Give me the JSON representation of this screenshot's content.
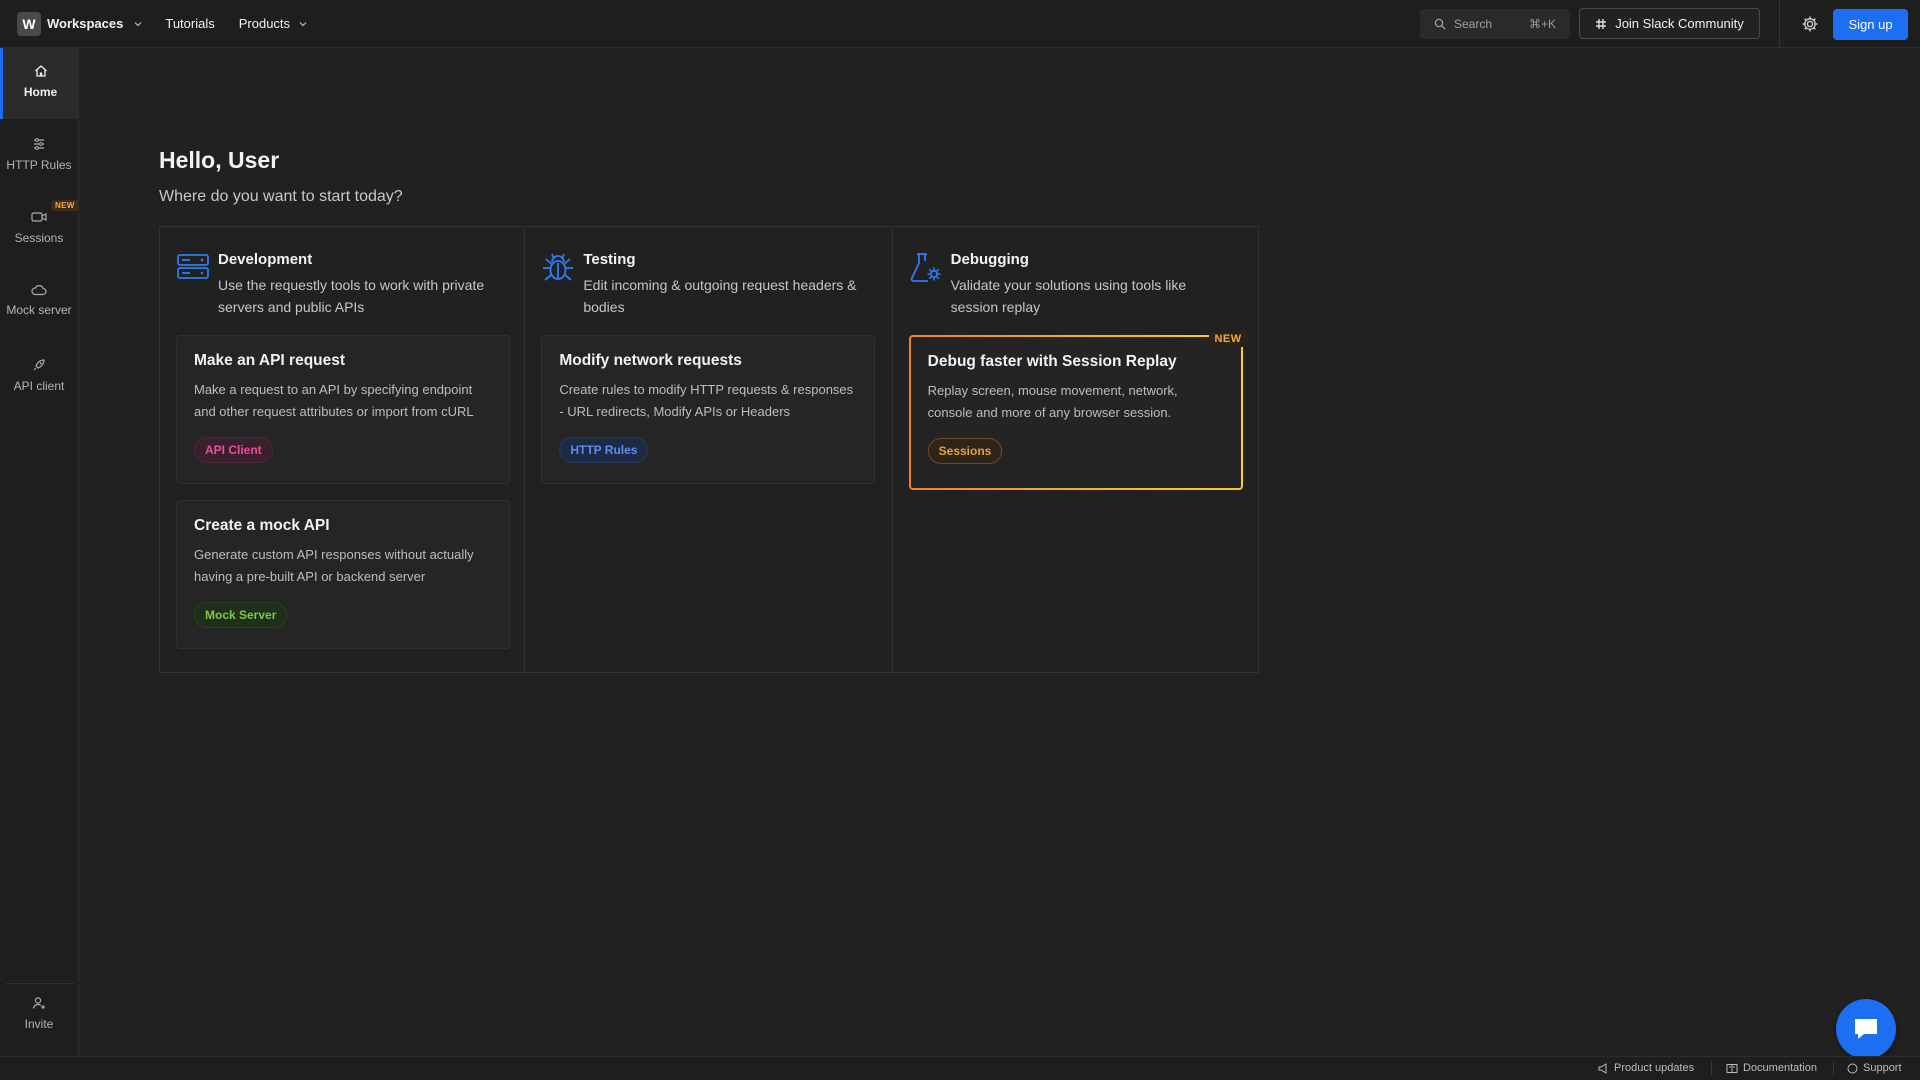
{
  "topbar": {
    "workspace_initial": "W",
    "workspace_label": "Workspaces",
    "tutorials": "Tutorials",
    "products": "Products",
    "search_label": "Search",
    "search_shortcut": "⌘+K",
    "slack_label": "Join Slack Community",
    "signup_label": "Sign up"
  },
  "sidebar": {
    "items": [
      {
        "label": "Home",
        "icon": "home-icon"
      },
      {
        "label": "HTTP Rules",
        "icon": "sliders-icon"
      },
      {
        "label": "Sessions",
        "icon": "video-icon",
        "badge": "NEW"
      },
      {
        "label": "Mock server",
        "icon": "cloud-icon"
      },
      {
        "label": "API client",
        "icon": "rocket-icon"
      }
    ],
    "invite_label": "Invite"
  },
  "main": {
    "greeting": "Hello, User",
    "subtitle": "Where do you want to start today?",
    "columns": [
      {
        "title": "Development",
        "description": "Use the requestly tools to work with private servers and public APIs",
        "icon": "server-icon",
        "cards": [
          {
            "title": "Make an API request",
            "description": "Make a request to an API by specifying endpoint and other request attributes or import from cURL",
            "tag": "API Client"
          },
          {
            "title": "Create a mock API",
            "description": "Generate custom API responses without actually having a pre-built API or backend server",
            "tag": "Mock Server"
          }
        ]
      },
      {
        "title": "Testing",
        "description": "Edit incoming & outgoing request headers & bodies",
        "icon": "bug-icon",
        "cards": [
          {
            "title": "Modify network requests",
            "description": "Create rules to modify HTTP requests & responses - URL redirects, Modify APIs or Headers",
            "tag": "HTTP Rules"
          }
        ]
      },
      {
        "title": "Debugging",
        "description": "Validate your solutions using tools like session replay",
        "icon": "flask-gear-icon",
        "cards": [
          {
            "title": "Debug faster with Session Replay",
            "description": "Replay screen, mouse movement, network, console and more of any browser session.",
            "tag": "Sessions",
            "badge": "NEW"
          }
        ]
      }
    ]
  },
  "footer": {
    "product_updates": "Product updates",
    "documentation": "Documentation",
    "support": "Support"
  },
  "colors": {
    "background": "#212121",
    "accent": "#1d6ff2",
    "new_badge": "#f2a93b"
  }
}
